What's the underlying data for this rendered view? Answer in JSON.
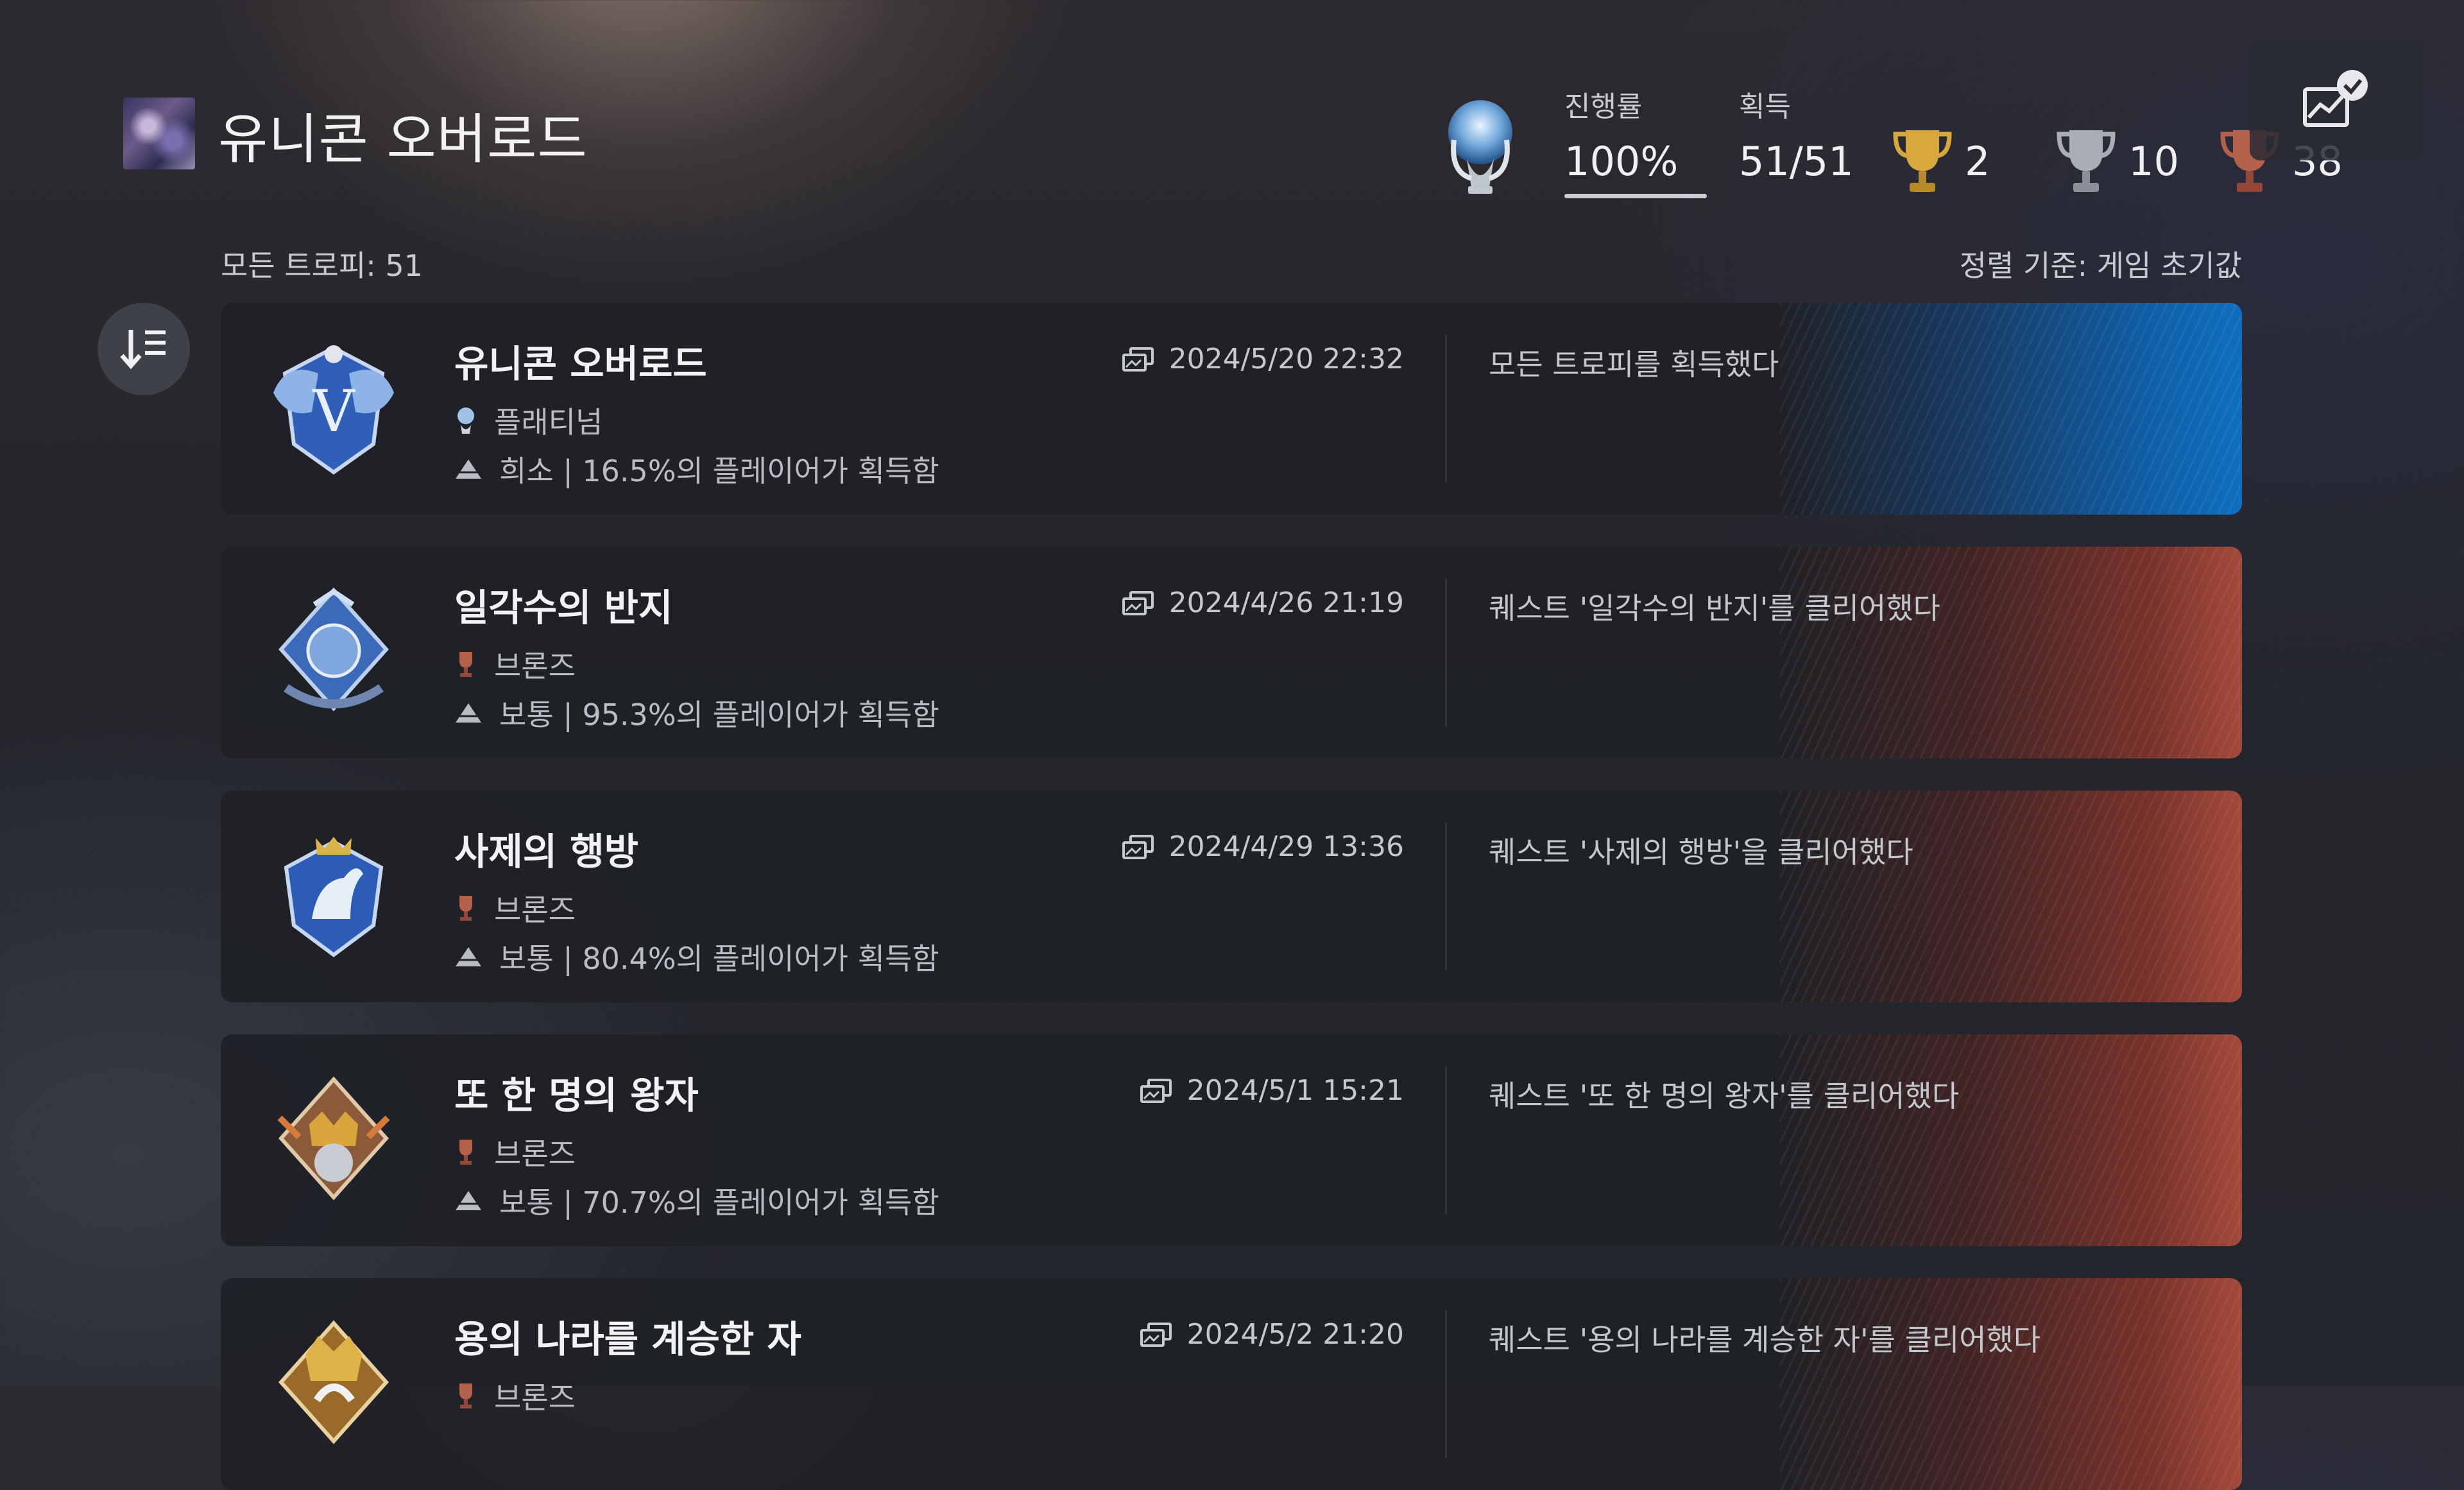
{
  "header": {
    "game_title": "유니콘 오버로드",
    "progress_label": "진행률",
    "progress_value": "100%",
    "progress_fraction": 1.0,
    "earned_label": "획득",
    "earned_value": "51/51",
    "gold_count": "2",
    "silver_count": "10",
    "bronze_count": "38"
  },
  "list": {
    "total_label": "모든 트로피: 51",
    "sort_label": "정렬 기준: 게임 초기값"
  },
  "colors": {
    "platinum": "#9fc3e6",
    "gold": "#d8a83c",
    "silver": "#a9aeb6",
    "bronze": "#b4614c",
    "platinum_accent": "#0f5fa6",
    "bronze_accent": "#a34a3c"
  },
  "trophies": [
    {
      "name": "유니콘 오버로드",
      "grade": "플래티넘",
      "grade_icon": "platinum-trophy-icon",
      "rarity": "희소 | 16.5%의 플레이어가 획득함",
      "date": "2024/5/20  22:32",
      "description": "모든 트로피를 획득했다"
    },
    {
      "name": "일각수의 반지",
      "grade": "브론즈",
      "grade_icon": "bronze-trophy-icon",
      "rarity": "보통 | 95.3%의 플레이어가 획득함",
      "date": "2024/4/26  21:19",
      "description": "퀘스트 '일각수의 반지'를 클리어했다"
    },
    {
      "name": "사제의 행방",
      "grade": "브론즈",
      "grade_icon": "bronze-trophy-icon",
      "rarity": "보통 | 80.4%의 플레이어가 획득함",
      "date": "2024/4/29  13:36",
      "description": "퀘스트 '사제의 행방'을 클리어했다"
    },
    {
      "name": "또 한 명의 왕자",
      "grade": "브론즈",
      "grade_icon": "bronze-trophy-icon",
      "rarity": "보통 | 70.7%의 플레이어가 획득함",
      "date": "2024/5/1  15:21",
      "description": "퀘스트 '또 한 명의 왕자'를 클리어했다"
    },
    {
      "name": "용의 나라를 계승한 자",
      "grade": "브론즈",
      "grade_icon": "bronze-trophy-icon",
      "rarity": "",
      "date": "2024/5/2  21:20",
      "description": "퀘스트 '용의 나라를 계승한 자'를 클리어했다"
    }
  ]
}
